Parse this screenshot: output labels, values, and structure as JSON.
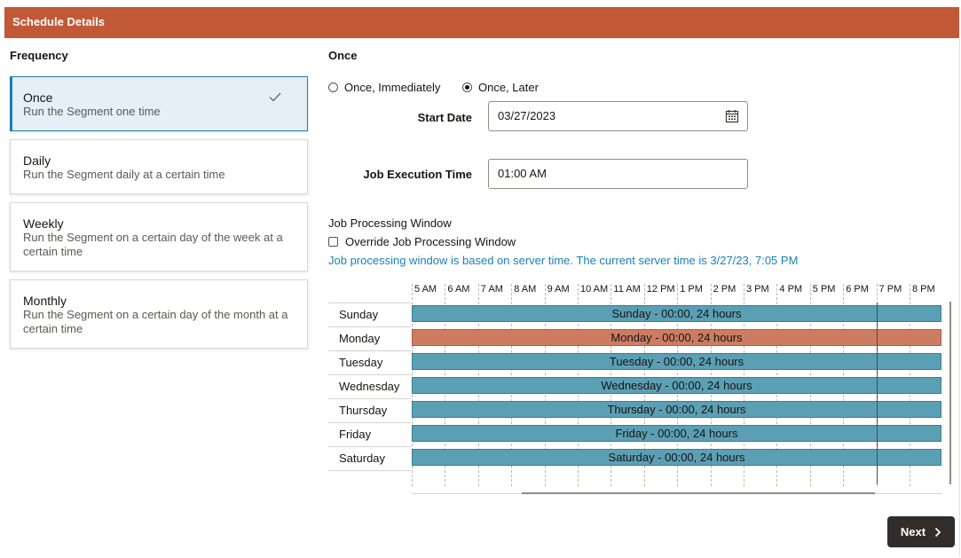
{
  "header": {
    "title": "Schedule Details"
  },
  "frequency": {
    "label": "Frequency",
    "options": [
      {
        "title": "Once",
        "desc": "Run the Segment one time",
        "selected": true
      },
      {
        "title": "Daily",
        "desc": "Run the Segment daily at a certain time"
      },
      {
        "title": "Weekly",
        "desc": "Run the Segment on a certain day of the week at a certain time"
      },
      {
        "title": "Monthly",
        "desc": "Run the Segment on a certain day of the month at a certain time"
      }
    ]
  },
  "once": {
    "label": "Once",
    "radio_immediately": "Once, Immediately",
    "radio_later": "Once, Later",
    "selected": "Once, Later",
    "start_date_label": "Start Date",
    "start_date_value": "03/27/2023",
    "exec_time_label": "Job Execution Time",
    "exec_time_value": "01:00 AM"
  },
  "window": {
    "label": "Job Processing Window",
    "override_label": "Override Job Processing Window",
    "override_checked": false,
    "info": "Job processing window is based on server time. The current server time is 3/27/23, 7:05 PM",
    "hours": [
      "5 AM",
      "6 AM",
      "7 AM",
      "8 AM",
      "9 AM",
      "10 AM",
      "11 AM",
      "12 PM",
      "1 PM",
      "2 PM",
      "3 PM",
      "4 PM",
      "5 PM",
      "6 PM",
      "7 PM",
      "8 PM"
    ],
    "days": [
      {
        "day": "Sunday",
        "bar": "Sunday - 00:00, 24 hours"
      },
      {
        "day": "Monday",
        "bar": "Monday - 00:00, 24 hours",
        "highlight": true
      },
      {
        "day": "Tuesday",
        "bar": "Tuesday - 00:00, 24 hours"
      },
      {
        "day": "Wednesday",
        "bar": "Wednesday - 00:00, 24 hours"
      },
      {
        "day": "Thursday",
        "bar": "Thursday - 00:00, 24 hours"
      },
      {
        "day": "Friday",
        "bar": "Friday - 00:00, 24 hours"
      },
      {
        "day": "Saturday",
        "bar": "Saturday - 00:00, 24 hours"
      }
    ],
    "colors": {
      "bar": "#5b9fb5",
      "highlight": "#cd7c62"
    }
  },
  "footer": {
    "next_label": "Next"
  }
}
